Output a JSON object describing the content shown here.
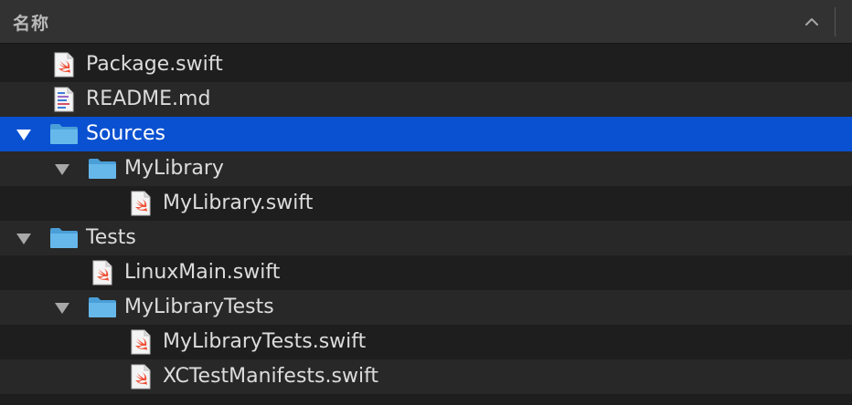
{
  "header": {
    "column_title": "名称"
  },
  "rows": [
    {
      "label": "Package.swift",
      "icon": "swift-file-icon"
    },
    {
      "label": "README.md",
      "icon": "markdown-file-icon"
    },
    {
      "label": "Sources",
      "icon": "folder-icon",
      "expanded": true,
      "selected": true
    },
    {
      "label": "MyLibrary",
      "icon": "folder-icon",
      "expanded": true
    },
    {
      "label": "MyLibrary.swift",
      "icon": "swift-file-icon"
    },
    {
      "label": "Tests",
      "icon": "folder-icon",
      "expanded": true
    },
    {
      "label": "LinuxMain.swift",
      "icon": "swift-file-icon"
    },
    {
      "label": "MyLibraryTests",
      "icon": "folder-icon",
      "expanded": true
    },
    {
      "label": "MyLibraryTests.swift",
      "icon": "swift-file-icon"
    },
    {
      "label": "XCTestManifests.swift",
      "icon": "swift-file-icon"
    }
  ],
  "colors": {
    "selection": "#0a51d1",
    "folder": "#5aaee3",
    "swift": "#f05138"
  }
}
